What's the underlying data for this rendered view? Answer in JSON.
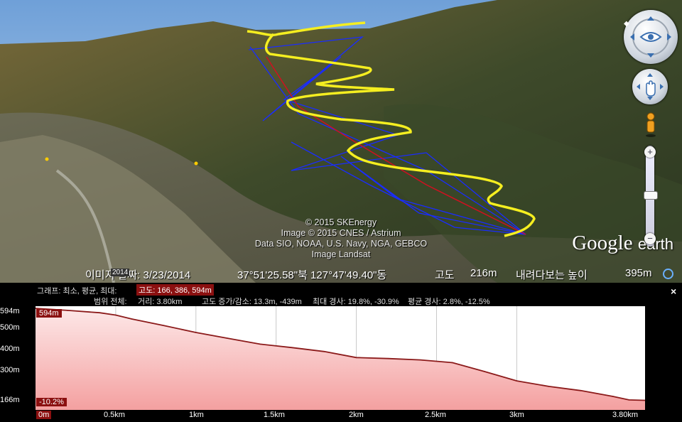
{
  "attribution": {
    "lines": [
      "© 2015 SKEnergy",
      "Image © 2015 CNES / Astrium",
      "Data SIO, NOAA, U.S. Navy, NGA, GEBCO",
      "Image Landsat"
    ]
  },
  "brand": {
    "google": "Google",
    "earth": "earth"
  },
  "status": {
    "image_date_label": "이미지 날짜: 3/23/2014",
    "year_badge": "2014",
    "coords": "37°51'25.58\"북 127°47'49.40\"동",
    "elev_label": "고도",
    "elev_value": "216m",
    "eye_label": "내려다보는 높이",
    "eye_value": "395m"
  },
  "profile_panel": {
    "graph_label": "그래프: 최소, 평균, 최대:",
    "elev_stats": "고도: 166, 386, 594m",
    "range_label": "범위 전체:",
    "distance": "거리: 3.80km",
    "gain_loss": "고도 증가/감소: 13.3m, -439m",
    "max_slope": "최대 경사: 19.8%, -30.9%",
    "avg_slope": "평균 경사: 2.8%, -12.5%",
    "close": "×",
    "top_marker": "594m",
    "bottom_marker": "-10.2%",
    "origin_marker": "0m"
  },
  "chart_data": {
    "type": "area",
    "y_ticks": [
      "594m",
      "500m",
      "400m",
      "300m",
      "166m"
    ],
    "x_ticks": [
      "0m",
      "0.5km",
      "1km",
      "1.5km",
      "2km",
      "2.5km",
      "3km",
      "3.80km"
    ],
    "ylim": [
      166,
      594
    ],
    "xlim": [
      0,
      3.8
    ],
    "x": [
      0,
      0.2,
      0.4,
      0.5,
      0.6,
      0.8,
      1.0,
      1.2,
      1.4,
      1.6,
      1.8,
      2.0,
      2.2,
      2.4,
      2.6,
      2.8,
      3.0,
      3.2,
      3.4,
      3.6,
      3.7,
      3.8
    ],
    "y": [
      594,
      585,
      575,
      565,
      548,
      520,
      490,
      465,
      440,
      425,
      408,
      382,
      378,
      372,
      360,
      322,
      282,
      258,
      240,
      215,
      200,
      198
    ],
    "line_color": "#8b1a1a",
    "fill_color": "#f4a0a0"
  }
}
